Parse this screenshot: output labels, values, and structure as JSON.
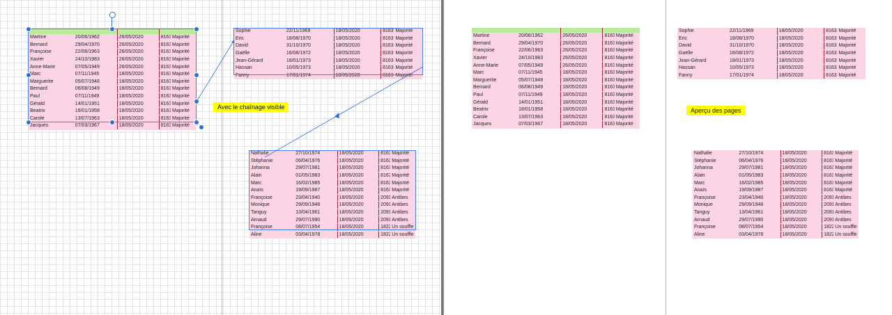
{
  "editor": {
    "callout": "Avec le chaînage visible",
    "page_size": "8163 - Majorité",
    "table1": [
      [
        "Martine",
        "20/06/1962",
        "26/05/2020",
        "8163",
        "Majorité"
      ],
      [
        "Bernard",
        "29/04/1970",
        "26/05/2020",
        "8163",
        "Majorité"
      ],
      [
        "Françoise",
        "22/06/1963",
        "26/05/2020",
        "8163",
        "Majorité"
      ],
      [
        "Xavier",
        "24/10/1983",
        "26/05/2020",
        "8163",
        "Majorité"
      ],
      [
        "Anne-Marie",
        "07/05/1949",
        "26/05/2020",
        "8163",
        "Majorité"
      ],
      [
        "Marc",
        "07/11/1945",
        "18/05/2020",
        "8163",
        "Majorité"
      ],
      [
        "Marguerite",
        "05/07/1948",
        "18/05/2020",
        "8163",
        "Majorité"
      ],
      [
        "Bernard",
        "06/08/1949",
        "18/05/2020",
        "8163",
        "Majorité"
      ],
      [
        "Paul",
        "07/11/1949",
        "18/05/2020",
        "8163",
        "Majorité"
      ],
      [
        "Gérald",
        "14/01/1951",
        "18/05/2020",
        "8163",
        "Majorité"
      ],
      [
        "Beatrix",
        "18/01/1958",
        "18/05/2020",
        "8163",
        "Majorité"
      ],
      [
        "Carole",
        "13/07/1963",
        "18/05/2020",
        "8163",
        "Majorité"
      ],
      [
        "Jacques",
        "07/03/1967",
        "18/05/2020",
        "8163",
        "Majorité"
      ]
    ],
    "table2": [
      [
        "Sophie",
        "22/11/1969",
        "18/05/2020",
        "8163",
        "Majorité"
      ],
      [
        "Eric",
        "18/08/1970",
        "18/05/2020",
        "8163",
        "Majorité"
      ],
      [
        "David",
        "31/10/1970",
        "18/05/2020",
        "8163",
        "Majorité"
      ],
      [
        "Gaëlle",
        "16/08/1972",
        "18/05/2020",
        "8163",
        "Majorité"
      ],
      [
        "Jean-Gérard",
        "18/01/1973",
        "18/05/2020",
        "8163",
        "Majorité"
      ],
      [
        "Hassan",
        "10/05/1973",
        "18/05/2020",
        "8163",
        "Majorité"
      ],
      [
        "Fanny",
        "17/01/1974",
        "18/05/2020",
        "8163",
        "Majorité"
      ]
    ],
    "table3": [
      [
        "Nathalie",
        "27/10/1974",
        "18/05/2020",
        "8163",
        "Majorité"
      ],
      [
        "Stéphanie",
        "06/04/1976",
        "18/05/2020",
        "8163",
        "Majorité"
      ],
      [
        "Johanna",
        "29/07/1981",
        "18/05/2020",
        "8163",
        "Majorité"
      ],
      [
        "Alain",
        "01/05/1983",
        "18/05/2020",
        "8163",
        "Majorité"
      ],
      [
        "Marc",
        "16/02/1985",
        "18/05/2020",
        "8163",
        "Majorité"
      ],
      [
        "Anaïs",
        "19/09/1987",
        "18/05/2020",
        "8163",
        "Majorité"
      ],
      [
        "Françoise",
        "23/04/1940",
        "18/05/2020",
        "2091",
        "Antibes"
      ],
      [
        "Monique",
        "29/09/1948",
        "18/05/2020",
        "2091",
        "Antibes"
      ],
      [
        "Tanguy",
        "13/04/1961",
        "18/05/2020",
        "2091",
        "Antibes"
      ],
      [
        "Arnaud",
        "29/07/1990",
        "18/05/2020",
        "2091",
        "Antibes"
      ],
      [
        "Françoise",
        "08/07/1954",
        "18/05/2020",
        "1822",
        "Un souffle"
      ],
      [
        "Aline",
        "03/04/1978",
        "18/05/2020",
        "1822",
        "Un souffle"
      ]
    ]
  },
  "preview": {
    "callout": "Aperçu des pages"
  },
  "colors": {
    "row_bg": "#fcd4e6",
    "header_bg": "#b9ec9a",
    "column_rule": "#9a1e3a",
    "selection": "#2e6fd6",
    "callout_bg": "#ffff00"
  }
}
